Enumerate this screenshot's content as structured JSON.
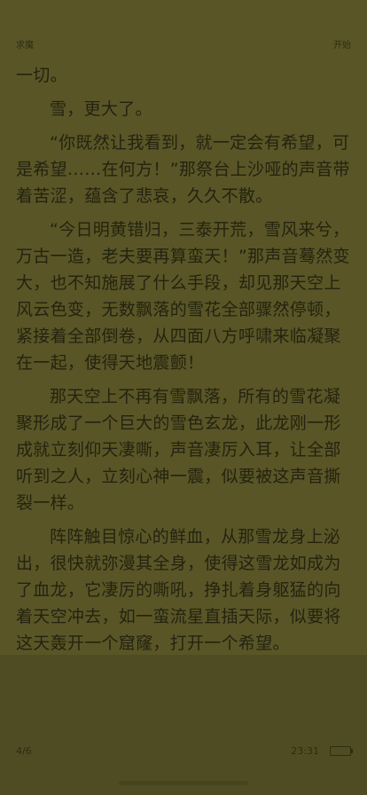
{
  "header": {
    "left_label": "求魔",
    "right_label": "开始"
  },
  "content": {
    "paragraphs": [
      "一切。",
      "雪，更大了。",
      "“你既然让我看到，就一定会有希望，可是希望……在何方！”那祭台上沙哑的声音带着苦涩，蕴含了悲哀，久久不散。",
      "“今日明黄错归，三泰开荒，雪风来兮，万古一造，老夫要再算蛮天！”那声音蓦然变大，也不知施展了什么手段，却见那天空上风云色变，无数飘落的雪花全部骤然停顿，紧接着全部倒卷，从四面八方呼啸来临凝聚在一起，使得天地震颤！",
      "那天空上不再有雪飘落，所有的雪花凝聚形成了一个巨大的雪色玄龙，此龙刚一形成就立刻仰天凄嘶，声音凄厉入耳，让全部听到之人，立刻心神一震，似要被这声音撕裂一样。",
      "阵阵触目惊心的鲜血，从那雪龙身上泌出，很快就弥漫其全身，使得这雪龙如成为了血龙，它凄厉的嘶吼，挣扎着身躯猛的向着天空冲去，如一蛮流星直插天际，似要将这天轰开一个窟窿，打开一个希望。"
    ]
  },
  "footer": {
    "page_indicator": "4/6",
    "time": "23:31"
  },
  "icons": {
    "battery": "battery-icon"
  }
}
